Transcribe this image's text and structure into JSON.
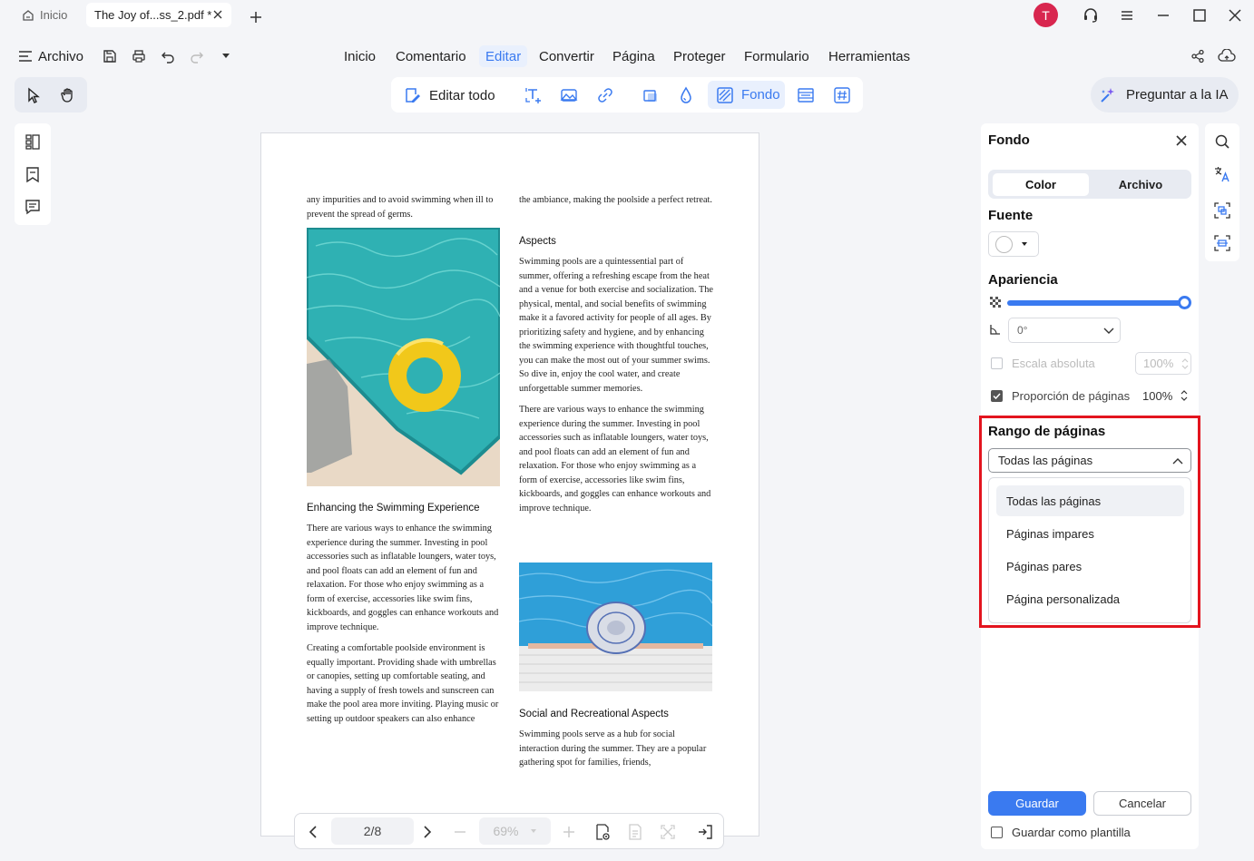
{
  "titlebar": {
    "home_tab": "Inicio",
    "doc_tab": "The Joy of...ss_2.pdf *",
    "avatar_letter": "T"
  },
  "menu": {
    "file": "Archivo",
    "items": [
      "Inicio",
      "Comentario",
      "Editar",
      "Convertir",
      "Página",
      "Proteger",
      "Formulario",
      "Herramientas"
    ]
  },
  "toolbar": {
    "edit_all": "Editar todo",
    "background": "Fondo",
    "ask_ai": "Preguntar a la IA"
  },
  "document": {
    "col1": {
      "intro": "any impurities and to avoid swimming when ill to prevent the spread of germs.",
      "heading": "Enhancing the Swimming Experience",
      "p1": "There are various ways to enhance the swimming experience during the summer. Investing in pool accessories such as inflatable loungers, water toys, and pool floats can add an element of fun and relaxation. For those who enjoy swimming as a form of exercise, accessories like swim fins, kickboards, and goggles can enhance workouts and improve technique.",
      "p2": "Creating a comfortable poolside environment is equally important. Providing shade with umbrellas or canopies, setting up comfortable seating, and having a supply of fresh towels and sunscreen can make the pool area more inviting. Playing music or setting up outdoor speakers can also enhance"
    },
    "col2": {
      "intro": "the ambiance, making the poolside a perfect retreat.",
      "heading1": "Aspects",
      "p1": "Swimming pools are a quintessential part of summer, offering a refreshing escape from the heat and a venue for both exercise and socialization. The physical, mental, and social benefits of swimming make it a favored activity for people of all ages. By prioritizing safety and hygiene, and by enhancing the swimming experience with thoughtful touches, you can make the most out of your summer swims. So dive in, enjoy the cool water, and create unforgettable summer memories.",
      "p2": "There are various ways to enhance the swimming experience during the summer. Investing in pool accessories such as inflatable loungers, water toys, and pool floats can add an element of fun and relaxation. For those who enjoy swimming as a form of exercise, accessories like swim fins, kickboards, and goggles can enhance workouts and improve technique.",
      "heading2": "Social and Recreational Aspects",
      "p3": "Swimming pools serve as a hub for social interaction during the summer. They are a popular gathering spot for families, friends,"
    }
  },
  "pagenav": {
    "page": "2/8",
    "zoom": "69%"
  },
  "panel": {
    "title": "Fondo",
    "tab_color": "Color",
    "tab_file": "Archivo",
    "source_label": "Fuente",
    "appearance_label": "Apariencia",
    "opacity": 1.0,
    "rotation": "0°",
    "absolute_scale_label": "Escala absoluta",
    "absolute_scale_value": "100%",
    "absolute_scale_checked": false,
    "page_ratio_label": "Proporción de páginas",
    "page_ratio_value": "100%",
    "page_ratio_checked": true,
    "range_label": "Rango de páginas",
    "range_selected": "Todas las páginas",
    "range_options": [
      "Todas las páginas",
      "Páginas impares",
      "Páginas pares",
      "Página personalizada"
    ],
    "save": "Guardar",
    "cancel": "Cancelar",
    "save_template": "Guardar como plantilla"
  },
  "colors": {
    "accent": "#3a7af0",
    "highlight": "#e3141e",
    "avatar": "#d8264f"
  }
}
